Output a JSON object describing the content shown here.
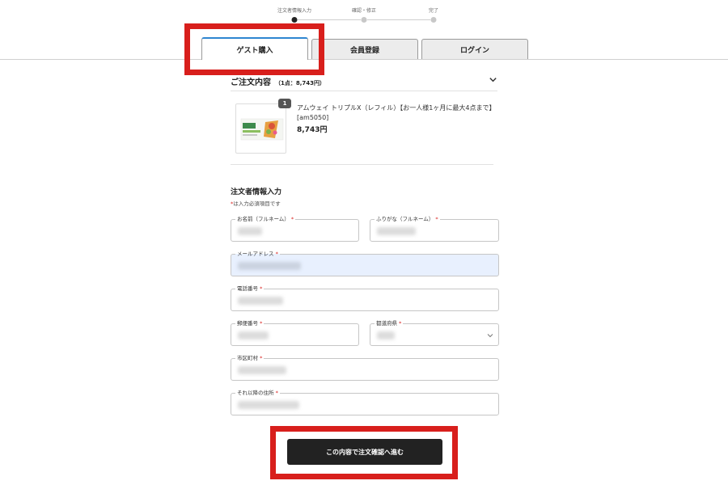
{
  "stepper": {
    "steps": [
      {
        "label": "注文者情報入力",
        "active": true
      },
      {
        "label": "確認・修正",
        "active": false
      },
      {
        "label": "完了",
        "active": false
      }
    ]
  },
  "tabs": [
    {
      "label": "ゲスト購入",
      "active": true
    },
    {
      "label": "会員登録",
      "active": false
    },
    {
      "label": "ログイン",
      "active": false
    }
  ],
  "summary": {
    "title": "ご注文内容",
    "count_text": "（1点：8,743円）",
    "item": {
      "quantity": "1",
      "name": "アムウェイ トリプルX（レフィル）【お一人様1ヶ月に最大4点まで】[am5050]",
      "price": "8,743円"
    }
  },
  "form": {
    "title": "注文者情報入力",
    "required_note": "は入力必須項目です",
    "required_mark": "*",
    "fields": {
      "name": {
        "label": "お名前（フルネーム）"
      },
      "furigana": {
        "label": "ふりがな（フルネーム）"
      },
      "email": {
        "label": "メールアドレス"
      },
      "phone": {
        "label": "電話番号"
      },
      "postal": {
        "label": "郵便番号"
      },
      "prefecture": {
        "label": "都道府県"
      },
      "city": {
        "label": "市区町村"
      },
      "address": {
        "label": "それ以降の住所"
      }
    }
  },
  "submit_label": "この内容で注文確認へ進む",
  "colors": {
    "accent": "#2f86d1",
    "highlight": "#d81f1c",
    "button": "#222222",
    "autofill": "#e8f0fe"
  }
}
